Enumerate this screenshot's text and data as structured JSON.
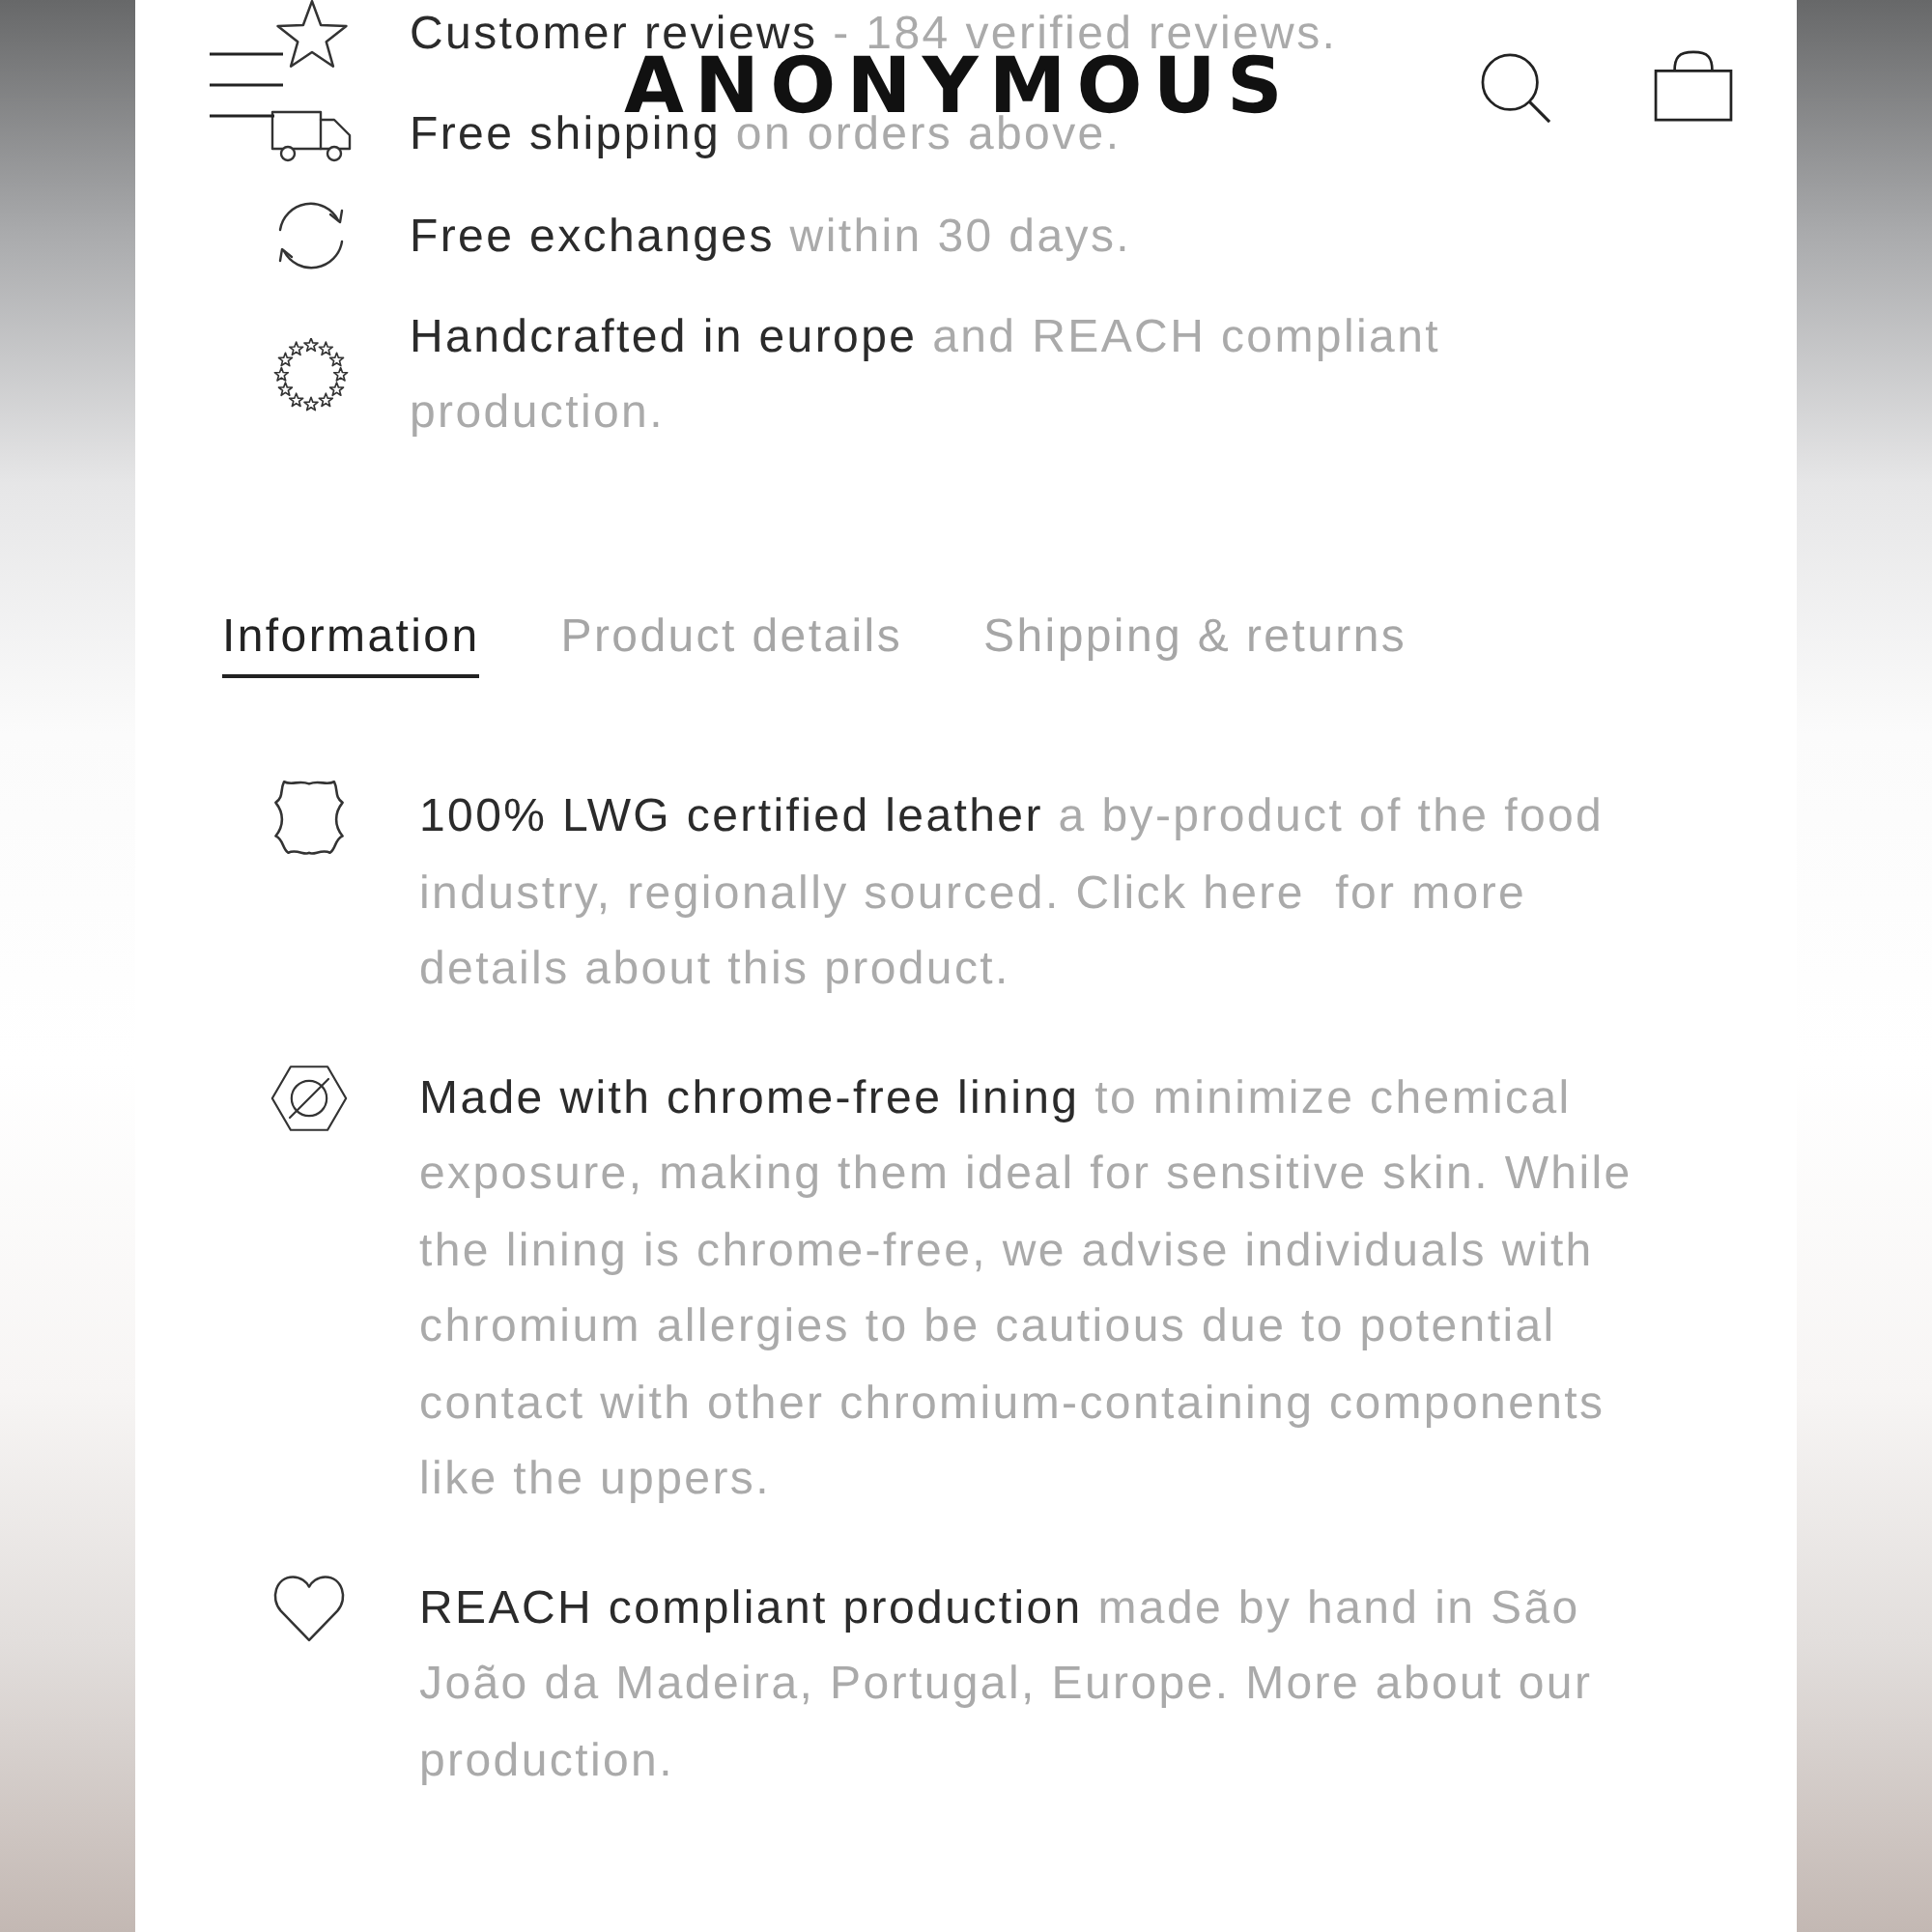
{
  "header": {
    "logo": "ANONYMOUS"
  },
  "features": [
    {
      "kind": "star",
      "title": "Customer reviews",
      "text": "- 184 verified reviews."
    },
    {
      "kind": "truck",
      "title": "Free shipping",
      "text": "on orders above."
    },
    {
      "kind": "exchange",
      "title": "Free exchanges",
      "text": "within 30 days."
    },
    {
      "kind": "eu-stars",
      "title": "Handcrafted in europe",
      "text": "and REACH compliant production."
    }
  ],
  "tabs": [
    {
      "label": "Information",
      "selected": true
    },
    {
      "label": "Product details",
      "selected": false
    },
    {
      "label": "Shipping & returns",
      "selected": false
    }
  ],
  "details": [
    {
      "kind": "leather",
      "title": "100% LWG certified leather",
      "text": "a by-product of the food industry, regionally sourced. Click here  for more details about this product."
    },
    {
      "kind": "chrome-free",
      "title": "Made with chrome-free lining",
      "text": "to minimize chemical exposure, making them ideal for sensitive skin. While the lining is chrome-free, we advise individuals with chromium allergies to be cautious due to potential contact with other chromium-containing components like the uppers."
    },
    {
      "kind": "heart",
      "title": "REACH compliant production",
      "text": "made by hand in São João da Madeira, Portugal, Europe. More about our production."
    }
  ]
}
